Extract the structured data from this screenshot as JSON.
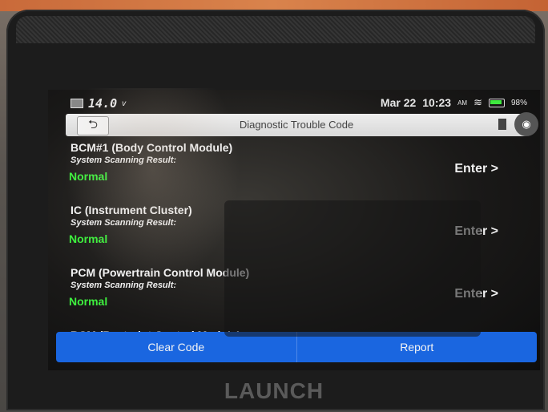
{
  "status": {
    "voltage": "14.0",
    "voltage_unit": "v",
    "date": "Mar 22",
    "time": "10:23",
    "ampm": "AM",
    "battery_pct": "98%"
  },
  "title": "Diagnostic Trouble Code",
  "modules": [
    {
      "name": "BCM#1 (Body Control Module)",
      "subtitle": "System Scanning Result:",
      "status": "Normal",
      "enter": "Enter >"
    },
    {
      "name": "IC (Instrument Cluster)",
      "subtitle": "System Scanning Result:",
      "status": "Normal",
      "enter": "Enter >"
    },
    {
      "name": "PCM (Powertrain Control Module)",
      "subtitle": "System Scanning Result:",
      "status": "Normal",
      "enter": "Enter >"
    },
    {
      "name": "RCM (Restraint Control Module)"
    }
  ],
  "buttons": {
    "clear": "Clear Code",
    "report": "Report"
  },
  "brand": "LAUNCH",
  "colors": {
    "status_ok": "#3ef03e",
    "button_blue": "#1a66e0"
  }
}
